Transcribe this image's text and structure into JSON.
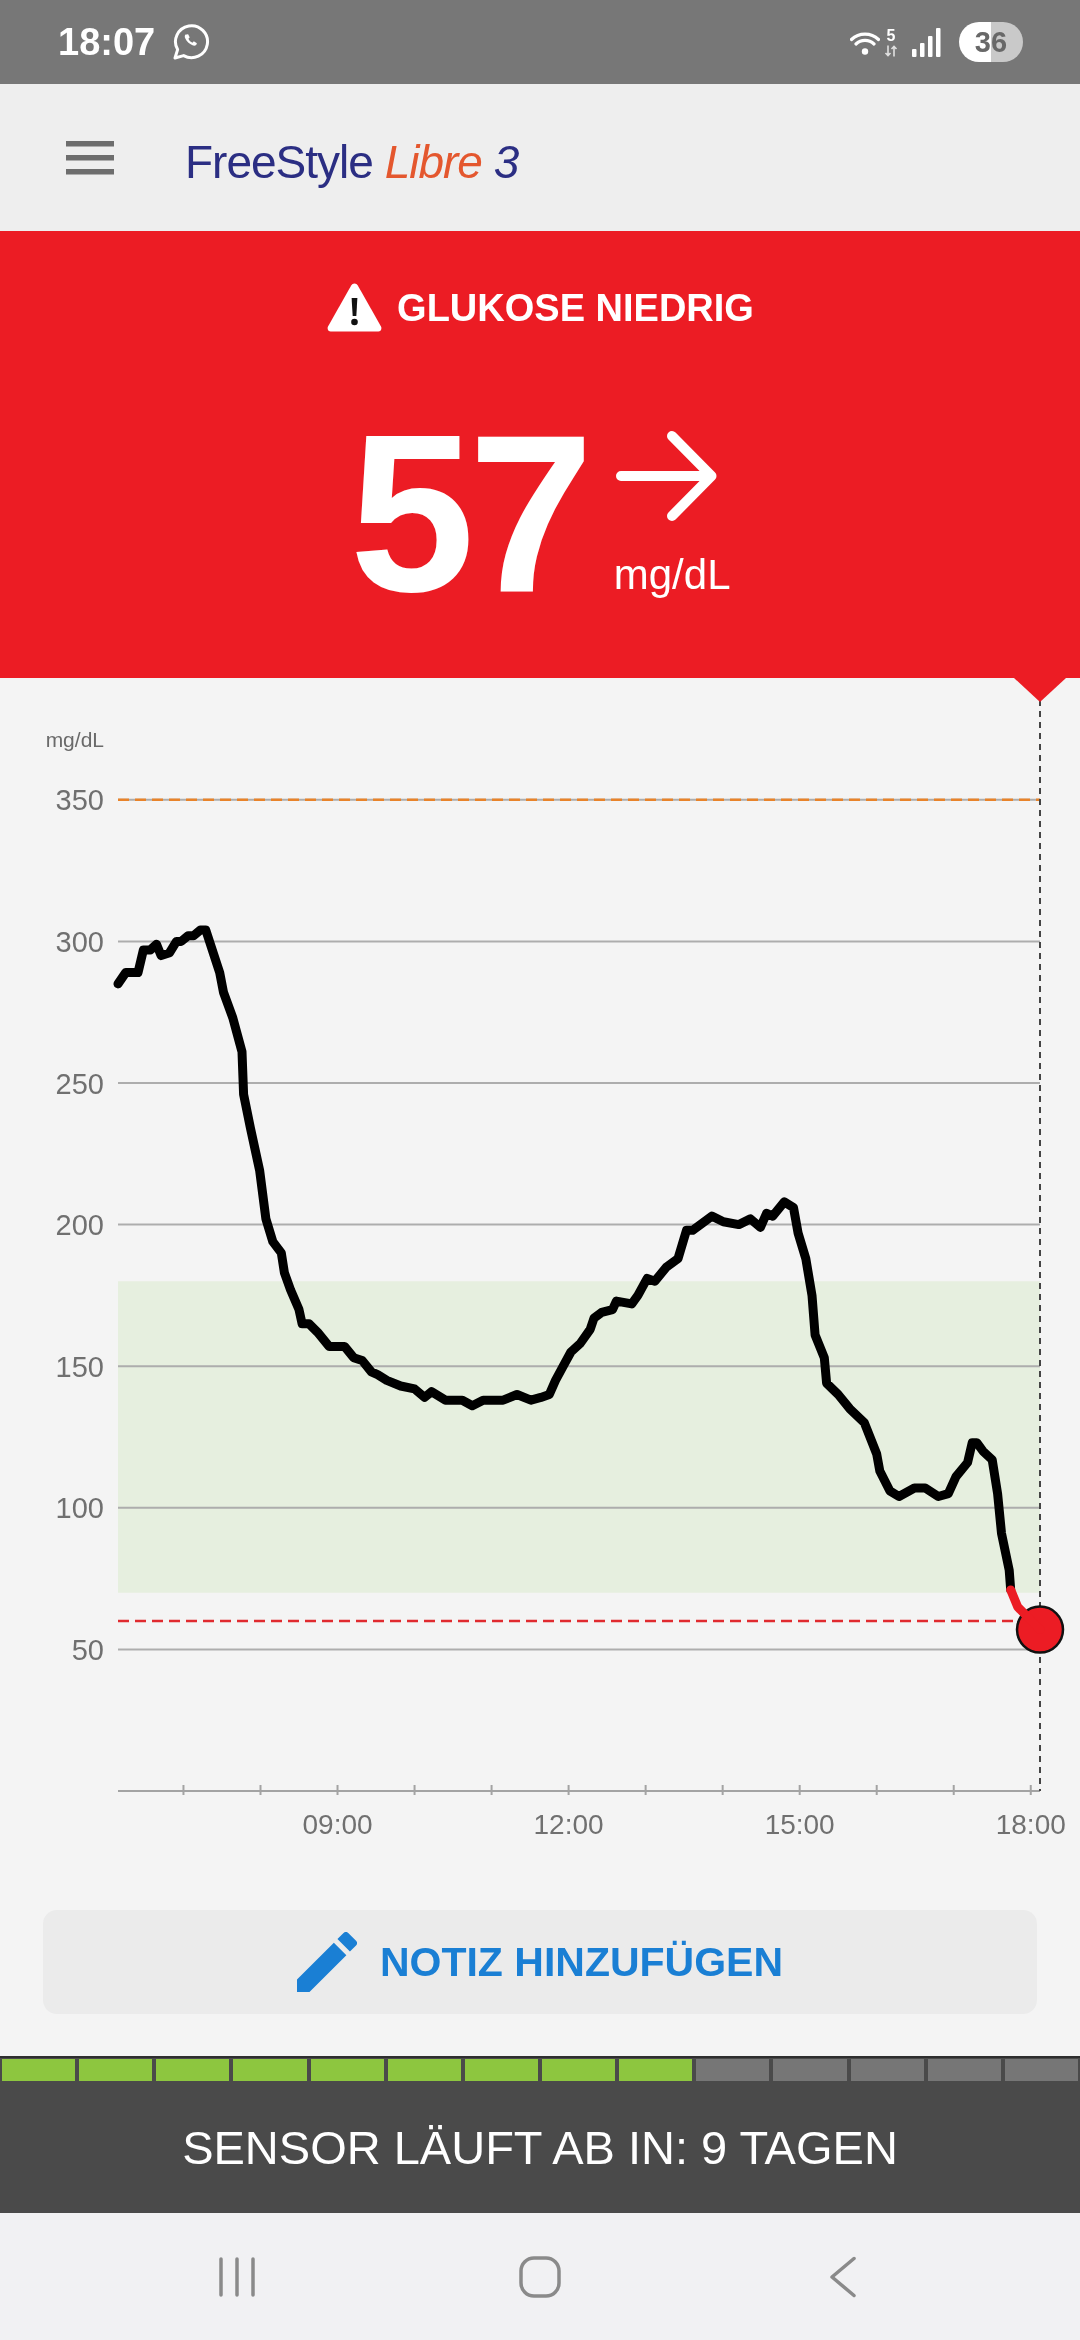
{
  "status_bar": {
    "time": "18:07",
    "network": "5",
    "battery": "36"
  },
  "header": {
    "logo": [
      {
        "text": "FreeStyle",
        "kind": "brand"
      },
      {
        "text": "Libre",
        "kind": "product"
      },
      {
        "text": "3",
        "kind": "version"
      }
    ]
  },
  "alert": {
    "kind": "low",
    "title": "GLUKOSE NIEDRIG",
    "value": "57",
    "trend": {
      "kind": "flat"
    },
    "unit": "mg/dL"
  },
  "chart": {
    "chart_data": {
      "type": "line",
      "ylabel": "mg/dL",
      "x": [
        6.15,
        6.25,
        6.41,
        6.48,
        6.57,
        6.65,
        6.71,
        6.82,
        6.91,
        6.97,
        7.06,
        7.13,
        7.22,
        7.29,
        7.47,
        7.52,
        7.64,
        7.76,
        7.78,
        7.87,
        7.99,
        8.07,
        8.16,
        8.27,
        8.31,
        8.39,
        8.5,
        8.54,
        8.63,
        8.74,
        8.89,
        9.09,
        9.21,
        9.32,
        9.44,
        9.52,
        9.64,
        9.82,
        10.0,
        10.13,
        10.22,
        10.4,
        10.62,
        10.75,
        10.89,
        11.15,
        11.33,
        11.51,
        11.64,
        11.75,
        11.83,
        11.93,
        12.03,
        12.15,
        12.28,
        12.33,
        12.43,
        12.57,
        12.62,
        12.82,
        12.9,
        13.02,
        13.12,
        13.27,
        13.42,
        13.53,
        13.61,
        13.86,
        14.01,
        14.21,
        14.36,
        14.49,
        14.57,
        14.65,
        14.8,
        14.92,
        14.98,
        15.08,
        15.16,
        15.2,
        15.32,
        15.35,
        15.5,
        15.65,
        15.84,
        16.0,
        16.04,
        16.17,
        16.29,
        16.49,
        16.63,
        16.8,
        16.93,
        17.03,
        17.18,
        17.24,
        17.3,
        17.38,
        17.5,
        17.57,
        17.62,
        17.72,
        17.74,
        17.83,
        18.12
      ],
      "series": [
        {
          "color": "#000000",
          "values": [
            285,
            289,
            289,
            297,
            297,
            299,
            295,
            296,
            300,
            300,
            302,
            302,
            304,
            304,
            289,
            282,
            273,
            261,
            246,
            234,
            219,
            202,
            194,
            190,
            183,
            177,
            170,
            165,
            165,
            162,
            157,
            157,
            153,
            152,
            148,
            147,
            145,
            143,
            142,
            139,
            141,
            138,
            138,
            136,
            138,
            138,
            140,
            138,
            139,
            140,
            145,
            150,
            155,
            158,
            163,
            167,
            169,
            170,
            173,
            172,
            175,
            181,
            180,
            185,
            188,
            198,
            198,
            203,
            201,
            200,
            202,
            199,
            204,
            203,
            208,
            206,
            197,
            188,
            175,
            161,
            153,
            144,
            140,
            135,
            130,
            119,
            113,
            106,
            104,
            107,
            107,
            104,
            105,
            111,
            116,
            123,
            123,
            120,
            117,
            105,
            91,
            78,
            71,
            null,
            null
          ]
        },
        {
          "color": "#ec1c24",
          "values": [
            null,
            null,
            null,
            null,
            null,
            null,
            null,
            null,
            null,
            null,
            null,
            null,
            null,
            null,
            null,
            null,
            null,
            null,
            null,
            null,
            null,
            null,
            null,
            null,
            null,
            null,
            null,
            null,
            null,
            null,
            null,
            null,
            null,
            null,
            null,
            null,
            null,
            null,
            null,
            null,
            null,
            null,
            null,
            null,
            null,
            null,
            null,
            null,
            null,
            null,
            null,
            null,
            null,
            null,
            null,
            null,
            null,
            null,
            null,
            null,
            null,
            null,
            null,
            null,
            null,
            null,
            null,
            null,
            null,
            null,
            null,
            null,
            null,
            null,
            null,
            null,
            null,
            null,
            null,
            null,
            null,
            null,
            null,
            null,
            null,
            null,
            null,
            null,
            null,
            null,
            null,
            null,
            null,
            null,
            null,
            null,
            null,
            null,
            null,
            null,
            null,
            null,
            71,
            65,
            57
          ]
        }
      ],
      "xlim": [
        6.15,
        18.12
      ],
      "ylim": [
        0,
        350
      ],
      "xticks": [
        {
          "value": 9,
          "label": "09:00"
        },
        {
          "value": 12,
          "label": "12:00"
        },
        {
          "value": 15,
          "label": "15:00"
        },
        {
          "value": 18,
          "label": "18:00"
        }
      ],
      "yticks": [
        50,
        100,
        150,
        200,
        250,
        300,
        350
      ],
      "grid": true,
      "bands": [
        {
          "axis": "y",
          "from": 70,
          "to": 180
        }
      ],
      "ref_lines": [
        {
          "axis": "y",
          "value": 350,
          "color": "#e8832a"
        },
        {
          "axis": "y",
          "value": 60,
          "color": "#e02a2f"
        }
      ]
    }
  },
  "note_button": {
    "label": "NOTIZ HINZUFÜGEN"
  },
  "sensor": {
    "segments": [
      {
        "filled": true
      },
      {
        "filled": true
      },
      {
        "filled": true
      },
      {
        "filled": true
      },
      {
        "filled": true
      },
      {
        "filled": true
      },
      {
        "filled": true
      },
      {
        "filled": true
      },
      {
        "filled": true
      },
      {
        "filled": false
      },
      {
        "filled": false
      },
      {
        "filled": false
      },
      {
        "filled": false
      },
      {
        "filled": false
      }
    ],
    "message": "SENSOR LÄUFT AB IN: 9 TAGEN"
  }
}
